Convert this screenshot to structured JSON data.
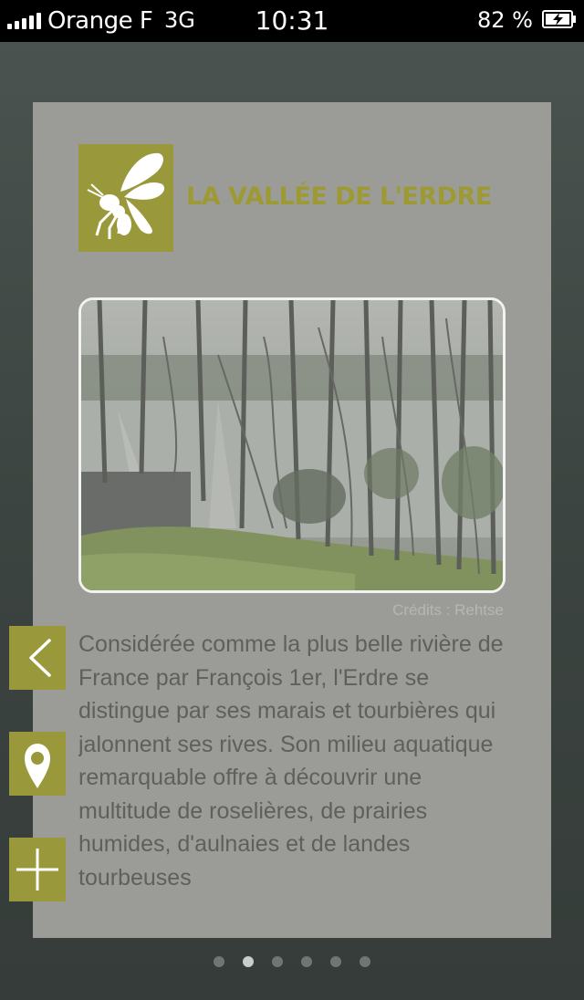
{
  "status_bar": {
    "carrier": "Orange F",
    "network": "3G",
    "time": "10:31",
    "battery": "82 %"
  },
  "card": {
    "title": "LA VALLÉE DE L'ERDRE",
    "logo_icon": "wasp-icon",
    "photo_credit": "Crédits : Rehtse",
    "description": "Considérée comme la plus belle rivière de France par François 1er, l'Erdre se distingue par ses marais et tourbières qui jalonnent ses rives. Son milieu aquatique remarquable offre à découvrir une multitude de roselières, de prairies humides, d'aulnaies et de landes tourbeuses"
  },
  "side_buttons": [
    {
      "icon": "chevron-left-icon"
    },
    {
      "icon": "map-pin-icon"
    },
    {
      "icon": "plus-icon"
    }
  ],
  "pagination": {
    "total_pages": 6,
    "current_page": 2
  },
  "colors": {
    "accent": "#99983a",
    "title": "#9e9a33",
    "card": "#9b9c98",
    "text": "#5e605d"
  }
}
